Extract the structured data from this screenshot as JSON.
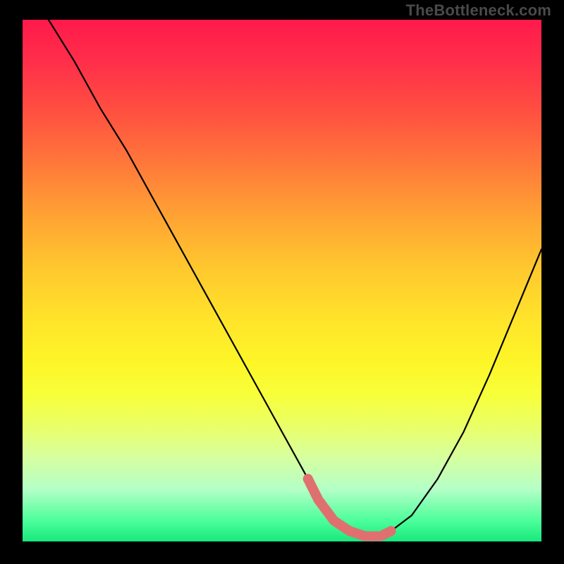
{
  "watermark": "TheBottleneck.com",
  "chart_data": {
    "type": "line",
    "title": "",
    "xlabel": "",
    "ylabel": "",
    "xlim": [
      0,
      100
    ],
    "ylim": [
      0,
      100
    ],
    "series": [
      {
        "name": "curve",
        "x": [
          5,
          10,
          15,
          20,
          25,
          30,
          35,
          40,
          45,
          50,
          55,
          57,
          60,
          63,
          66,
          69,
          71,
          75,
          80,
          85,
          90,
          95,
          100
        ],
        "values": [
          100,
          92,
          83,
          75,
          66,
          57,
          48,
          39,
          30,
          21,
          12,
          8,
          4,
          2,
          1,
          1,
          2,
          5,
          12,
          21,
          32,
          44,
          56
        ]
      }
    ],
    "highlight_segment": {
      "comment": "thick salmon overlay near the valley",
      "x": [
        55,
        57,
        60,
        63,
        66,
        69,
        71
      ],
      "values": [
        12,
        8,
        4,
        2,
        1,
        1,
        2
      ]
    },
    "highlight_dot_x": 55,
    "highlight_dot_y": 12,
    "colors": {
      "curve": "#000000",
      "highlight": "#e07070",
      "gradient_top": "#ff1a4b",
      "gradient_bottom": "#18e87c"
    }
  }
}
